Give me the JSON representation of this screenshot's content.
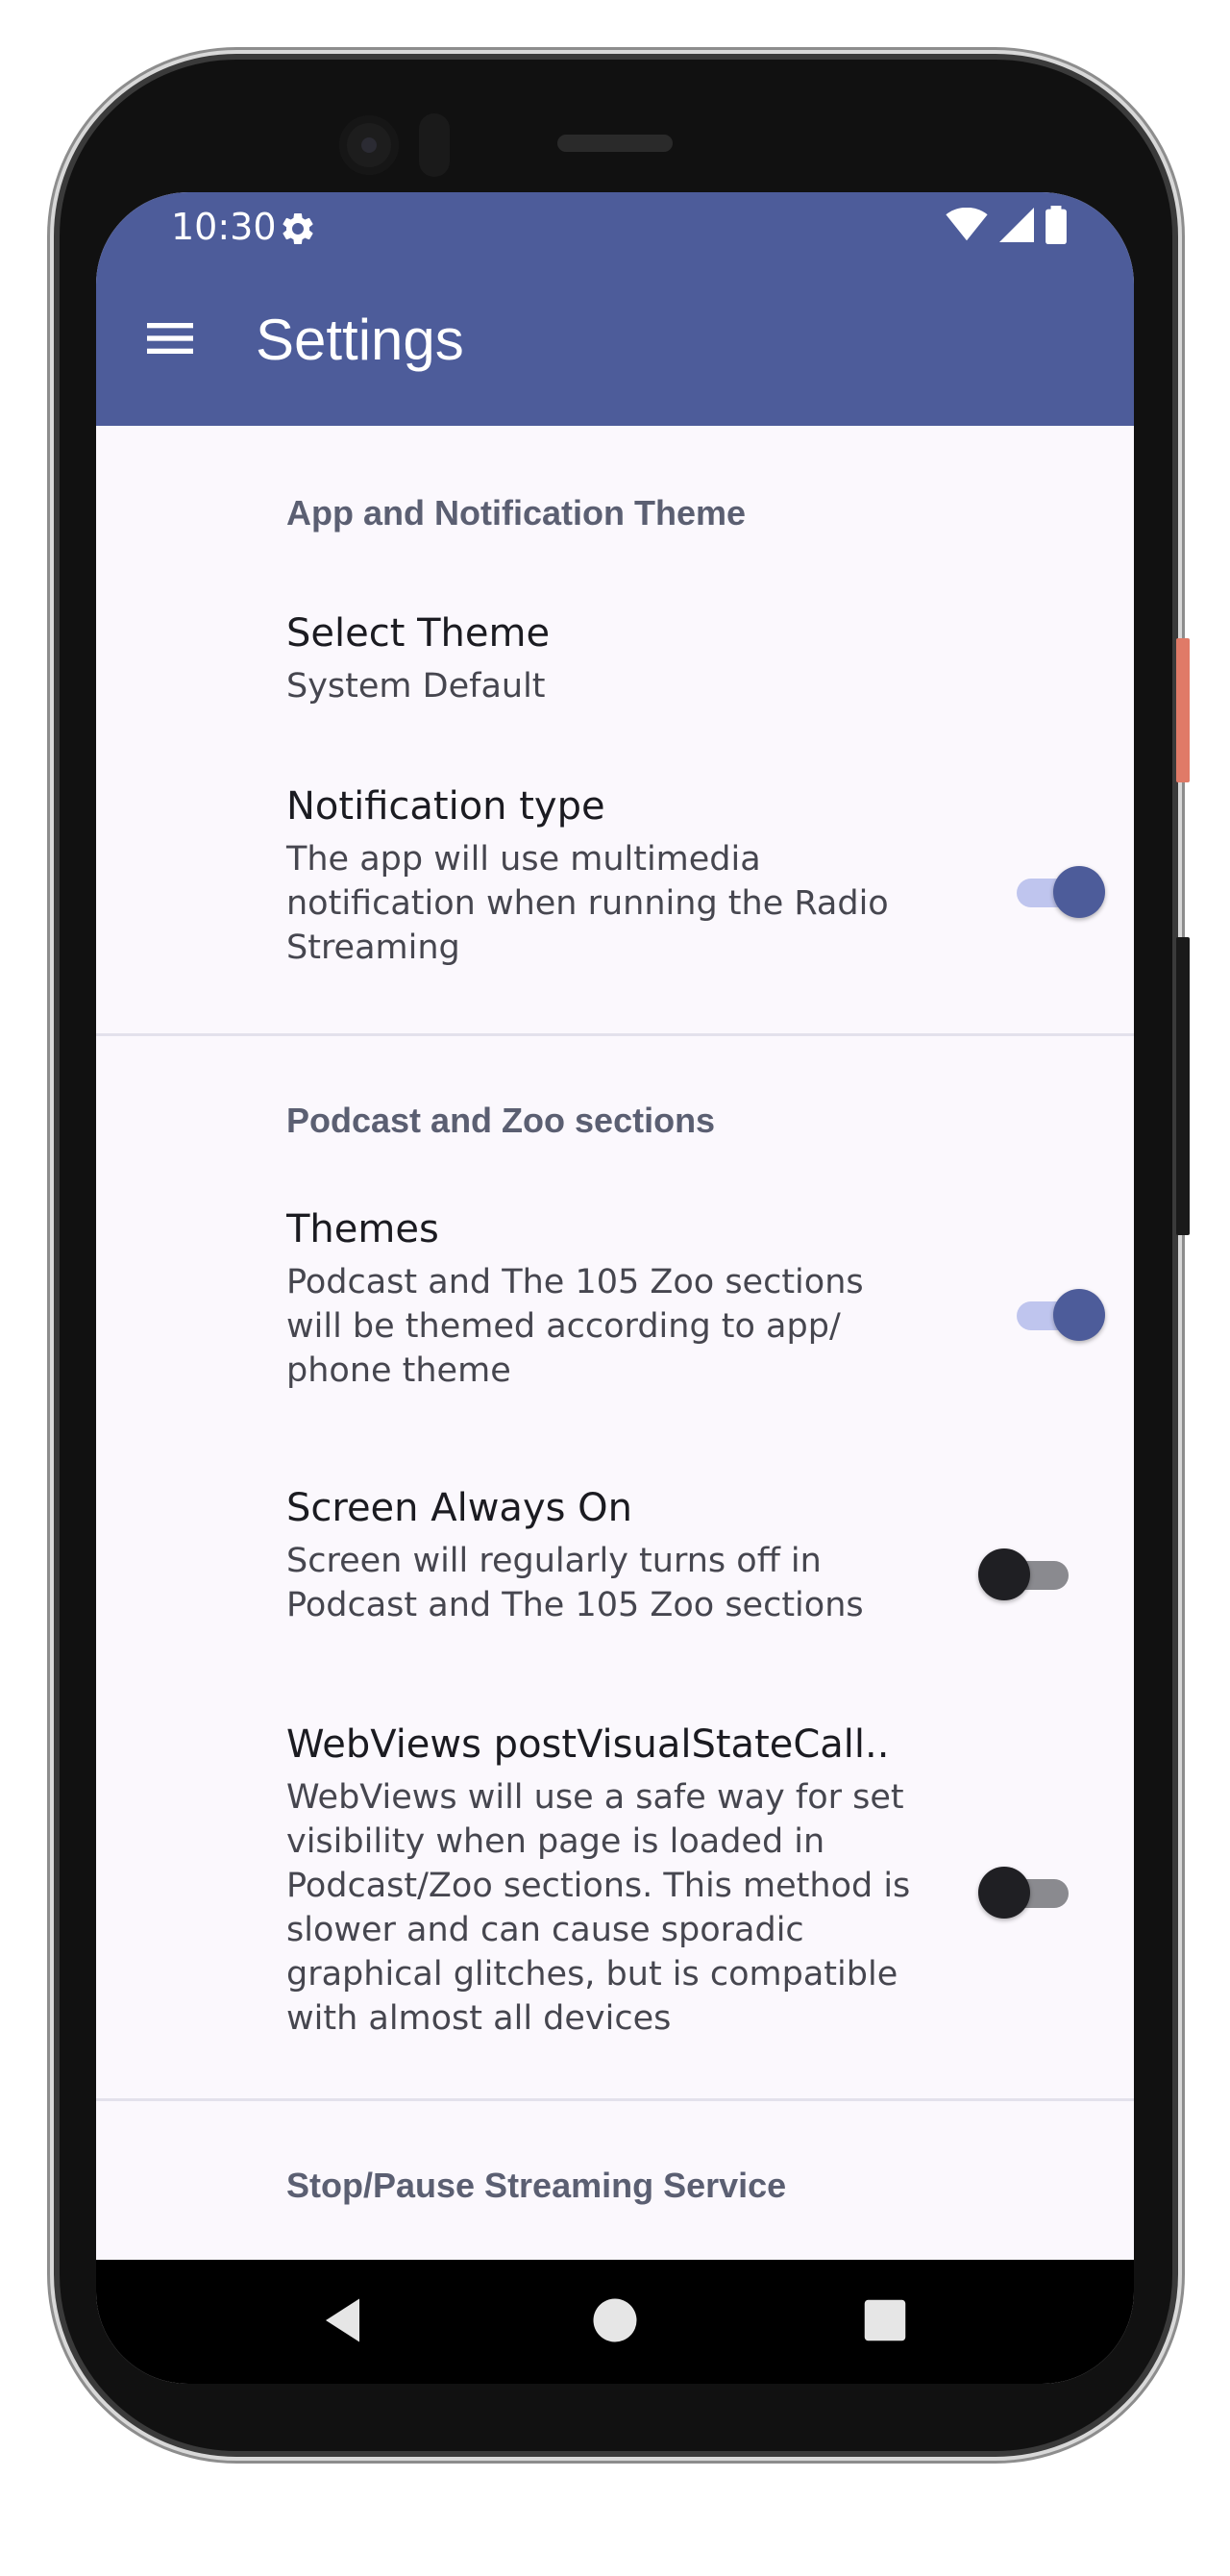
{
  "status_bar": {
    "time": "10:30",
    "settings_icon": "gear-icon",
    "wifi_icon": "wifi-icon",
    "signal_icon": "signal-icon",
    "battery_icon": "battery-icon"
  },
  "app_bar": {
    "menu_icon": "hamburger-menu-icon",
    "title": "Settings",
    "background_color": "#4d5c9a"
  },
  "sections": [
    {
      "header": "App and Notification Theme",
      "items": [
        {
          "title": "Select Theme",
          "summary": "System Default"
        },
        {
          "title": "Notification type",
          "summary": "The app will use multimedia notification when running the Radio Streaming",
          "switch_on": true
        }
      ]
    },
    {
      "header": "Podcast and Zoo sections",
      "items": [
        {
          "title": "Themes",
          "summary": "Podcast and The 105 Zoo sections will be themed according to app/ phone theme",
          "switch_on": true
        },
        {
          "title": "Screen Always On",
          "summary": "Screen will regularly turns off in Podcast and The 105 Zoo sections",
          "switch_on": false
        },
        {
          "title": "WebViews postVisualStateCall..",
          "summary": "WebViews will use a safe way for set visibility when page is loaded in Podcast/Zoo sections. This method is slower and can cause sporadic graphical glitches, but is compatible with almost all devices",
          "switch_on": false
        }
      ]
    },
    {
      "header": "Stop/Pause Streaming Service",
      "items": []
    }
  ],
  "nav_bar": {
    "back_icon": "back-triangle-icon",
    "home_icon": "home-circle-icon",
    "recents_icon": "recents-square-icon"
  }
}
